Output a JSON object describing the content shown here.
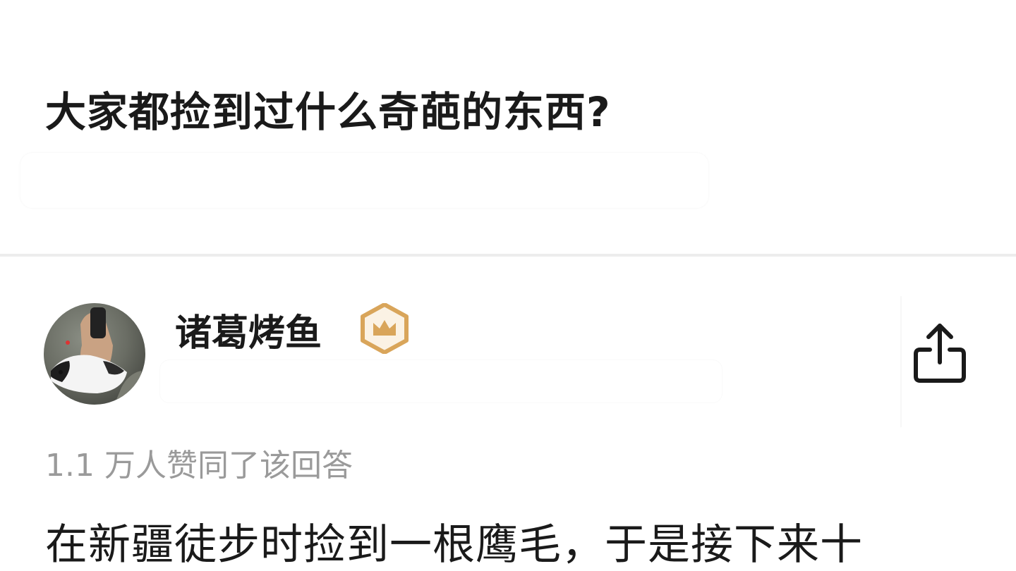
{
  "question": {
    "title": "大家都捡到过什么奇葩的东西?"
  },
  "author": {
    "name": "诸葛烤鱼",
    "avatar_icon": "avatar-photo",
    "badge_icon": "crown-badge-icon",
    "badge_color": "#d9a55a"
  },
  "actions": {
    "share_icon": "share-icon"
  },
  "answer": {
    "vote_text": "1.1 万人赞同了该回答",
    "text_plain": "在新疆徒步时捡到一根鹰毛，",
    "text_link": "于是接下来十"
  },
  "colors": {
    "title": "#1a1a1a",
    "meta": "#9a9a9a",
    "divider": "#ededed"
  }
}
